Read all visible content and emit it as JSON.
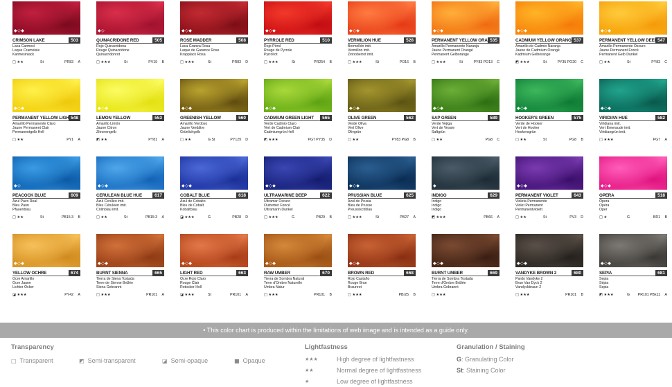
{
  "colors": [
    {
      "name": "CRIMSON LAKE",
      "number": "503",
      "translations": [
        "Laca Carmesí",
        "Laque Cramoisie",
        "Karmesinlack"
      ],
      "symbol": "□ ★★",
      "gs": "St",
      "pigment": "PR83",
      "permanence": "A",
      "swatch": [
        "#7a0a1e",
        "#c01f3e",
        "#a3102e"
      ],
      "marks": "◆◇◆"
    },
    {
      "name": "QUINACRIDONE RED",
      "number": "505",
      "translations": [
        "Rojo Quinacridona",
        "Rouge Quinacridone",
        "Quinacridonrot"
      ],
      "symbol": "□ ★★★",
      "gs": "St",
      "pigment": "PV19",
      "permanence": "B",
      "swatch": [
        "#a0122e",
        "#d82e4a",
        "#b81834"
      ],
      "marks": "◆◇"
    },
    {
      "name": "ROSE MADDER",
      "number": "508",
      "translations": [
        "Laca Granza Rosa",
        "Laque de Garance Rose",
        "Krapplack Rosa"
      ],
      "symbol": "□ ★★★",
      "gs": "St",
      "pigment": "PR83",
      "permanence": "D",
      "swatch": [
        "#7c0e16",
        "#c12a32",
        "#a41820"
      ],
      "marks": "◆◇◆"
    },
    {
      "name": "PYRROLE RED",
      "number": "510",
      "translations": [
        "Rojo Pirrol",
        "Rouge de Pyrrole",
        "Pyrrolrot"
      ],
      "symbol": "□ ★★★",
      "gs": "St",
      "pigment": "PR254",
      "permanence": "B",
      "swatch": [
        "#c20c12",
        "#f2382a",
        "#dd1c1a"
      ],
      "marks": "◆◇◆"
    },
    {
      "name": "VERMILION HUE",
      "number": "528",
      "translations": [
        "Bermellón imit.",
        "Vermillon imit.",
        "Zinnoberrot imit."
      ],
      "symbol": "□ ★★★",
      "gs": "St",
      "pigment": "PO16",
      "permanence": "B",
      "swatch": [
        "#e53a16",
        "#ff7a40",
        "#f05526"
      ],
      "marks": "◆◇◆"
    },
    {
      "name": "PERMANENT YELLOW ORANGE",
      "number": "535",
      "translations": [
        "Amarillo Permanente Naranja",
        "Jaune Permanent Orangé",
        "Permanent Gelborange"
      ],
      "symbol": "□ ★★★",
      "gs": "St",
      "pigment": "PY83 PO13",
      "permanence": "C",
      "swatch": [
        "#f06a10",
        "#ffae3a",
        "#f68a1c"
      ],
      "marks": "◆◇◆"
    },
    {
      "name": "CADMIUM YELLOW ORANGE",
      "number": "537",
      "translations": [
        "Amarillo de Cadmio Naranja",
        "Jaune de Cadmium Orangé",
        "Kadmium Gelborange"
      ],
      "symbol": "◩ ★★★",
      "gs": "St",
      "pigment": "PY35 PO20",
      "permanence": "C",
      "swatch": [
        "#f57a08",
        "#ffb326",
        "#fa9612"
      ],
      "marks": "◆◇◆"
    },
    {
      "name": "PERMANENT YELLOW DEEP",
      "number": "547",
      "translations": [
        "Amarillo Permanente Oscuro",
        "Jaune Permanent Foncé",
        "Permanent Gelb Dunkel"
      ],
      "symbol": "□ ★★",
      "gs": "St",
      "pigment": "PY83",
      "permanence": "C",
      "swatch": [
        "#f59a08",
        "#ffca3c",
        "#f8b012"
      ],
      "marks": "◆◇◆"
    },
    {
      "name": "PERMANENT YELLOW LIGHT",
      "number": "548",
      "translations": [
        "Amarillo Permanente Claro",
        "Jaune Permanent Clair",
        "Permanentgelb Hell"
      ],
      "symbol": "□ ★★",
      "gs": "",
      "pigment": "PY1",
      "permanence": "A",
      "swatch": [
        "#efc80a",
        "#fff04a",
        "#f6dc1c"
      ],
      "marks": "◆◇◆"
    },
    {
      "name": "LEMON YELLOW",
      "number": "553",
      "translations": [
        "Amarillo Limón",
        "Jaune Citron",
        "Zitronengelb"
      ],
      "symbol": "◩ ★★",
      "gs": "",
      "pigment": "PY81",
      "permanence": "A",
      "swatch": [
        "#e3e010",
        "#fcfb62",
        "#eded2a"
      ],
      "marks": "◆◇◆"
    },
    {
      "name": "GREENISH YELLOW",
      "number": "560",
      "translations": [
        "Amarillo Verdoso",
        "Jaune Verdâtre",
        "Grünlichgelb"
      ],
      "symbol": "□ ★★",
      "gs": "G St",
      "pigment": "PY129",
      "permanence": "D",
      "swatch": [
        "#5f4b0f",
        "#b8a22e",
        "#8c741c"
      ],
      "marks": "◆◇◆"
    },
    {
      "name": "CADMIUM GREEN LIGHT",
      "number": "565",
      "translations": [
        "Verde Cadmio Claro",
        "Vert de Cadmium Clair",
        "Cadmiumgrün Hell"
      ],
      "symbol": "◩ ★★★",
      "gs": "",
      "pigment": "PG7 PY35",
      "permanence": "D",
      "swatch": [
        "#5ca212",
        "#a8d83a",
        "#7fbd22"
      ],
      "marks": "◆◇◆"
    },
    {
      "name": "OLIVE GREEN",
      "number": "562",
      "translations": [
        "Verde Oliva",
        "Vert Olive",
        "Olivgrün"
      ],
      "symbol": "□ ★★",
      "gs": "",
      "pigment": "PY83 PG8",
      "permanence": "B",
      "swatch": [
        "#5a5212",
        "#a3942e",
        "#7d721c"
      ],
      "marks": "◆◇◆"
    },
    {
      "name": "SAP GREEN",
      "number": "589",
      "translations": [
        "Verde Vejiga",
        "Vert de Vessie",
        "Saftgrün"
      ],
      "symbol": "□ ★★",
      "gs": "",
      "pigment": "PG8",
      "permanence": "C",
      "swatch": [
        "#2c6e12",
        "#6cae36",
        "#4a8e22"
      ],
      "marks": "◆◇◆"
    },
    {
      "name": "HOOKER'S GREEN",
      "number": "575",
      "translations": [
        "Verde de Hooker",
        "Vert de Hooker",
        "Hookersgrün"
      ],
      "symbol": "□ ★★",
      "gs": "St",
      "pigment": "PG8",
      "permanence": "B",
      "swatch": [
        "#0e7a34",
        "#3cb65c",
        "#1e9446"
      ],
      "marks": "◆◇◆"
    },
    {
      "name": "VIRIDIAN HUE",
      "number": "582",
      "translations": [
        "Viridiana imit.",
        "Vert Émeraude imit.",
        "Viridiangrün imit."
      ],
      "symbol": "□ ★★★",
      "gs": "",
      "pigment": "PG7",
      "permanence": "A",
      "swatch": [
        "#08584c",
        "#21a38c",
        "#10806c"
      ],
      "marks": "◆◇◆"
    },
    {
      "name": "PEACOCK BLUE",
      "number": "609",
      "translations": [
        "Azul Pavo Real",
        "Bleu Paon",
        "Pfauenblau"
      ],
      "symbol": "□ ★★",
      "gs": "St",
      "pigment": "PB15:3",
      "permanence": "B",
      "swatch": [
        "#0c5aa6",
        "#3a9ae2",
        "#1b78c8"
      ],
      "marks": "◆◇"
    },
    {
      "name": "CERULEAN BLUE HUE",
      "number": "617",
      "translations": [
        "Azul Cerúleo imit.",
        "Bleu Céruléen imit.",
        "Cölinblau imit."
      ],
      "symbol": "□ ★★",
      "gs": "St",
      "pigment": "PB15:3",
      "permanence": "A",
      "swatch": [
        "#1262b6",
        "#4ea6ea",
        "#2a84d2"
      ],
      "marks": "◆◇◆"
    },
    {
      "name": "COBALT BLUE",
      "number": "618",
      "translations": [
        "Azul de Cobalto",
        "Bleu de Cobalt",
        "Kobaltblau"
      ],
      "symbol": "◪ ★★★",
      "gs": "G",
      "pigment": "PB28",
      "permanence": "D",
      "swatch": [
        "#1a2e96",
        "#4b68d6",
        "#2a44b6"
      ],
      "marks": "◆◇◆"
    },
    {
      "name": "ULTRAMARINE DEEP",
      "number": "622",
      "translations": [
        "Ultramar Oscuro",
        "Outremer Foncé",
        "Ultramarin Dunkel"
      ],
      "symbol": "□ ★★★",
      "gs": "G",
      "pigment": "PB29",
      "permanence": "B",
      "swatch": [
        "#141c6e",
        "#3a46b2",
        "#222e90"
      ],
      "marks": "◆◇◆"
    },
    {
      "name": "PRUSSIAN BLUE",
      "number": "625",
      "translations": [
        "Azul de Prusia",
        "Bleu de Prusse",
        "Preussischblau"
      ],
      "symbol": "□ ★★★",
      "gs": "St",
      "pigment": "PB27",
      "permanence": "A",
      "swatch": [
        "#0a2c52",
        "#2a5e90",
        "#163f6c"
      ],
      "marks": "◆◇◆"
    },
    {
      "name": "INDIGO",
      "number": "629",
      "translations": [
        "Indigo",
        "Indigo",
        "Indigo"
      ],
      "symbol": "◩ ★★★",
      "gs": "",
      "pigment": "PB66",
      "permanence": "A",
      "swatch": [
        "#1c2a34",
        "#4a5c68",
        "#2e3e4a"
      ],
      "marks": "◆"
    },
    {
      "name": "PERMANENT VIOLET",
      "number": "643",
      "translations": [
        "Violeta Permanente",
        "Violet Permanent",
        "Permanentviolett"
      ],
      "symbol": "□ ★★",
      "gs": "St",
      "pigment": "PV3",
      "permanence": "D",
      "swatch": [
        "#3a0e6a",
        "#7a3ab0",
        "#56208c"
      ],
      "marks": "◆◇◆"
    },
    {
      "name": "OPERA",
      "number": "518",
      "translations": [
        "Ópera",
        "Opéra",
        "Oper"
      ],
      "symbol": "□ ★",
      "gs": "G",
      "pigment": "BR1",
      "permanence": "B",
      "swatch": [
        "#e0127e",
        "#ff5cb8",
        "#ee2e96"
      ],
      "marks": "◆◇◆"
    },
    {
      "name": "YELLOW OCHRE",
      "number": "674",
      "translations": [
        "Ocre Amarillo",
        "Ocre Jaune",
        "Lichter Ocker"
      ],
      "symbol": "◪ ★★★",
      "gs": "",
      "pigment": "PY42",
      "permanence": "A",
      "swatch": [
        "#d08a1e",
        "#f6c05a",
        "#e2a232"
      ],
      "marks": "◆◇◆"
    },
    {
      "name": "BURNT SIENNA",
      "number": "665",
      "translations": [
        "Tierra de Siena Tostada",
        "Terre de Sienne Brûlée",
        "Siena Gebrannt"
      ],
      "symbol": "□ ★★★",
      "gs": "",
      "pigment": "PR101",
      "permanence": "A",
      "swatch": [
        "#8e3a14",
        "#d0703a",
        "#ae4e20"
      ],
      "marks": "◆◇◆"
    },
    {
      "name": "LIGHT RED",
      "number": "663",
      "translations": [
        "Ocre Rojo Claro",
        "Rouge Clair",
        "Rotocker Hell"
      ],
      "symbol": "◪ ★★★",
      "gs": "St",
      "pigment": "PR101",
      "permanence": "A",
      "swatch": [
        "#a83c16",
        "#e2784a",
        "#c45424"
      ],
      "marks": "◆◇◆"
    },
    {
      "name": "RAW UMBER",
      "number": "670",
      "translations": [
        "Tierra de Sombra Natural",
        "Terre d'Ombre Naturelle",
        "Umbra Natur"
      ],
      "symbol": "□ ★★★",
      "gs": "",
      "pigment": "PR101",
      "permanence": "B",
      "swatch": [
        "#9a4e12",
        "#d4883a",
        "#b4661e"
      ],
      "marks": "◆◇◆"
    },
    {
      "name": "BROWN RED",
      "number": "668",
      "translations": [
        "Rojo Castaño",
        "Rouge Brun",
        "Braunrot"
      ],
      "symbol": "□ ★★★",
      "gs": "",
      "pigment": "PBr25",
      "permanence": "B",
      "swatch": [
        "#882e12",
        "#c86234",
        "#a6421e"
      ],
      "marks": "◆◇◆"
    },
    {
      "name": "BURNT UMBER",
      "number": "669",
      "translations": [
        "Tierra de Sombra Tostada",
        "Terre d'Ombre Brûlée",
        "Umbra Gebrannt"
      ],
      "symbol": "□ ★★★",
      "gs": "",
      "pigment": "",
      "permanence": "",
      "swatch": [
        "#3a1e12",
        "#7a4a32",
        "#56301e"
      ],
      "marks": "◆◇◆"
    },
    {
      "name": "VANDYKE BROWN 2",
      "number": "680",
      "translations": [
        "Pardo Vandyke 2",
        "Brun Van Dyck 2",
        "Vandyckbraun 2"
      ],
      "symbol": "□ ★★★",
      "gs": "",
      "pigment": "PR101",
      "permanence": "B",
      "swatch": [
        "#24201c",
        "#5a5048",
        "#3a342e"
      ],
      "marks": "◆◇◆"
    },
    {
      "name": "SEPIA",
      "number": "681",
      "translations": [
        "Sepia",
        "Sépia",
        "Sepia"
      ],
      "symbol": "◩ ★★★",
      "gs": "G",
      "pigment": "PR101 PBk11",
      "permanence": "A",
      "swatch": [
        "#3a3834",
        "#7c7874",
        "#55524e"
      ],
      "marks": "◆◇◆"
    }
  ],
  "banner": "• This color chart is produced within the limitations of web image and is intended as a guide only.",
  "legend": {
    "transparency": {
      "title": "Transparency",
      "items": [
        {
          "icon": "□",
          "label": "Transparent"
        },
        {
          "icon": "◩",
          "label": "Semi-transparent"
        },
        {
          "icon": "◪",
          "label": "Semi-opaque"
        },
        {
          "icon": "■",
          "label": "Opaque"
        }
      ]
    },
    "lightfastness": {
      "title": "Lightfastness",
      "items": [
        {
          "stars": "★★★",
          "label": "High degree of lightfastness"
        },
        {
          "stars": "★★",
          "label": "Normal degree of lightfastness"
        },
        {
          "stars": "★",
          "label": "Low degree of lightfastness"
        }
      ]
    },
    "granulation": {
      "title": "Granulation / Staining",
      "items": [
        {
          "key": "G",
          "label": ": Granulating Color"
        },
        {
          "key": "St",
          "label": ": Staining Color"
        }
      ]
    }
  }
}
